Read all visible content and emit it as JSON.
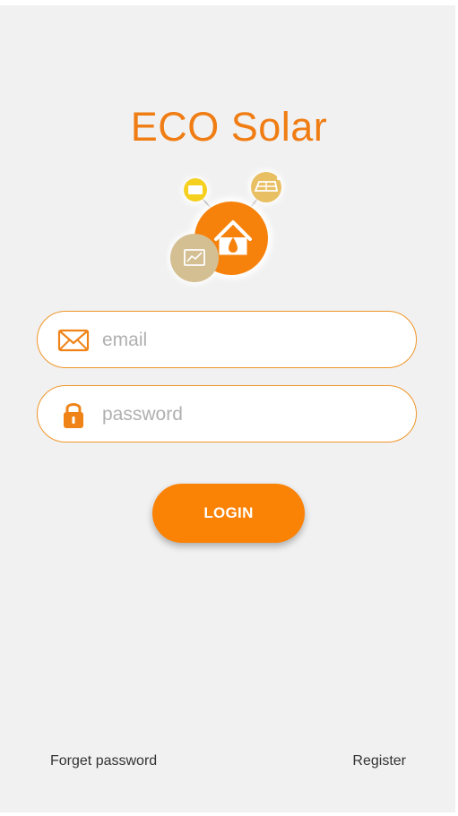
{
  "app": {
    "title": "ECO Solar"
  },
  "logo": {
    "icon": "eco-solar-logo",
    "accent_color": "#f07d14"
  },
  "form": {
    "email": {
      "placeholder": "email",
      "value": "",
      "icon": "envelope-icon"
    },
    "password": {
      "placeholder": "password",
      "value": "",
      "icon": "lock-icon"
    },
    "login_label": "LOGIN"
  },
  "footer": {
    "forget_password": "Forget password",
    "register": "Register"
  },
  "colors": {
    "accent": "#f07d14",
    "button": "#fa8205",
    "background": "#f1f1f1"
  }
}
